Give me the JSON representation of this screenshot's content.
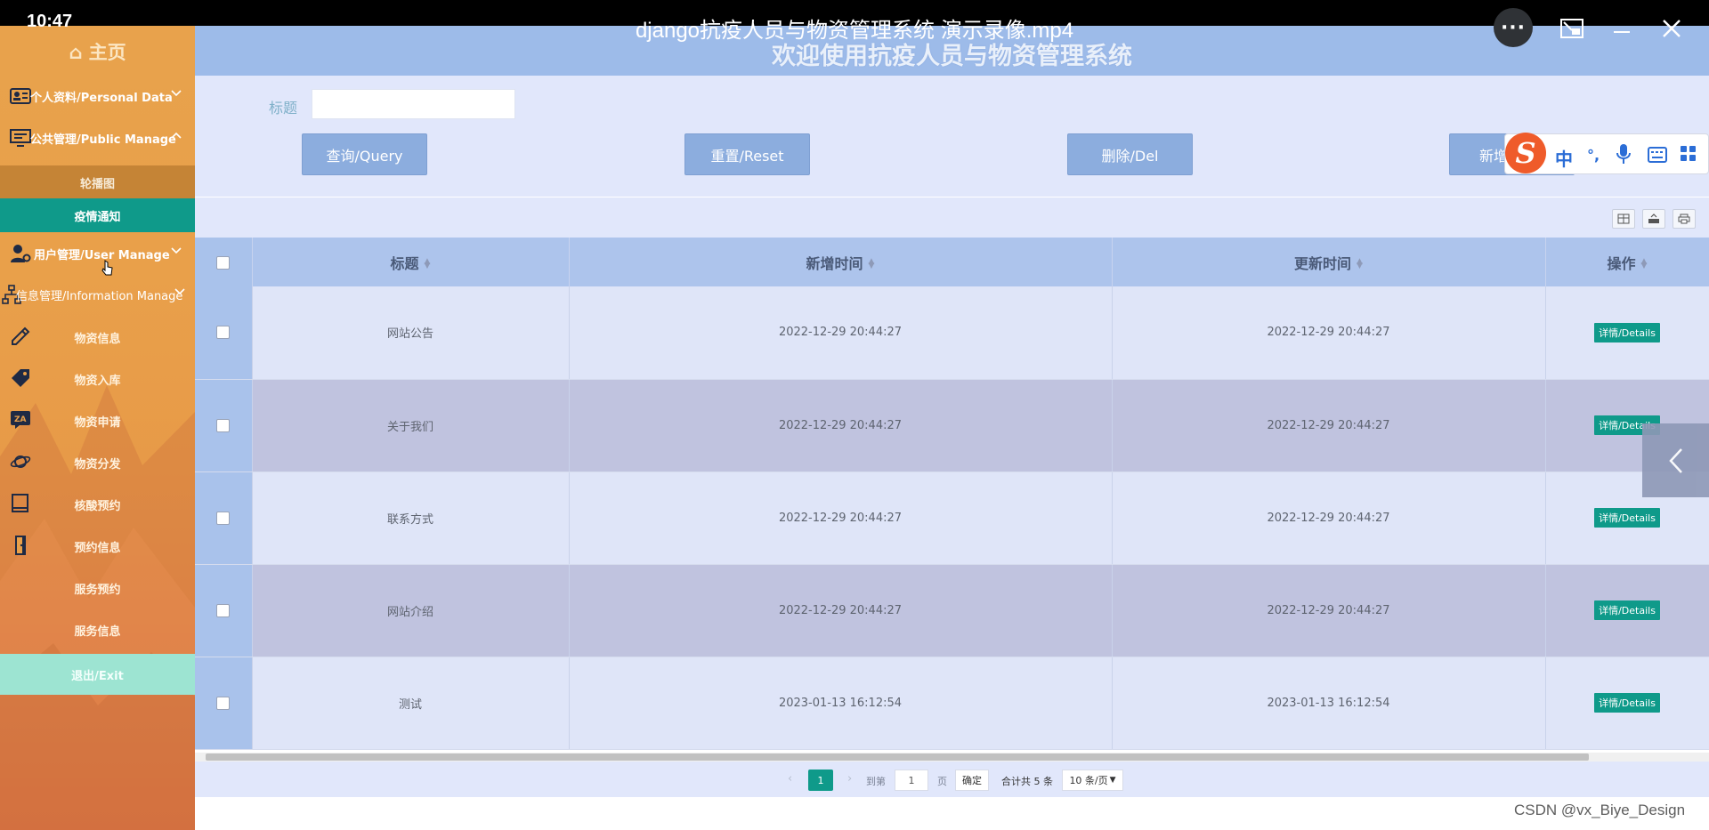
{
  "player": {
    "clock": "10:47",
    "video_title": "django抗疫人员与物资管理系统 演示录像.mp4",
    "more_label": "···"
  },
  "sidebar": {
    "home": "⌂ 主页",
    "groups": [
      {
        "label": "个人资料/Personal Data"
      },
      {
        "label": "公共管理/Public Manage"
      },
      {
        "label": "用户管理/User Manage"
      },
      {
        "label": "信息管理/Information Manage"
      }
    ],
    "public_sub": [
      "轮播图",
      "疫情通知"
    ],
    "info_items": [
      "物资信息",
      "物资入库",
      "物资申请",
      "物资分发",
      "核酸预约",
      "预约信息",
      "服务预约",
      "服务信息"
    ],
    "exit": "退出/Exit"
  },
  "header": {
    "title": "欢迎使用抗疫人员与物资管理系统"
  },
  "search": {
    "label": "标题",
    "value": "",
    "buttons": {
      "query": "查询/Query",
      "reset": "重置/Reset",
      "delete": "删除/Del",
      "add": "新增"
    }
  },
  "table": {
    "columns": [
      "标题",
      "新增时间",
      "更新时间",
      "操作"
    ],
    "rows": [
      {
        "title": "网站公告",
        "created": "2022-12-29 20:44:27",
        "updated": "2022-12-29 20:44:27",
        "action": "详情/Details"
      },
      {
        "title": "关于我们",
        "created": "2022-12-29 20:44:27",
        "updated": "2022-12-29 20:44:27",
        "action": "详情/Details"
      },
      {
        "title": "联系方式",
        "created": "2022-12-29 20:44:27",
        "updated": "2022-12-29 20:44:27",
        "action": "详情/Details"
      },
      {
        "title": "网站介绍",
        "created": "2022-12-29 20:44:27",
        "updated": "2022-12-29 20:44:27",
        "action": "详情/Details"
      },
      {
        "title": "测试",
        "created": "2023-01-13 16:12:54",
        "updated": "2023-01-13 16:12:54",
        "action": "详情/Details"
      }
    ]
  },
  "pager": {
    "current": "1",
    "goto_label": "到第",
    "goto_value": "1",
    "page_unit": "页",
    "confirm": "确定",
    "total": "合计共 5 条",
    "page_size": "10 条/页"
  },
  "ime": {
    "lang": "中",
    "punct": "°,"
  },
  "watermark": "CSDN @vx_Biye_Design",
  "colors": {
    "accent": "#0f9a8a",
    "sidebar": "#e8a24c",
    "header": "#9dbbe9",
    "button": "#8cadde"
  }
}
